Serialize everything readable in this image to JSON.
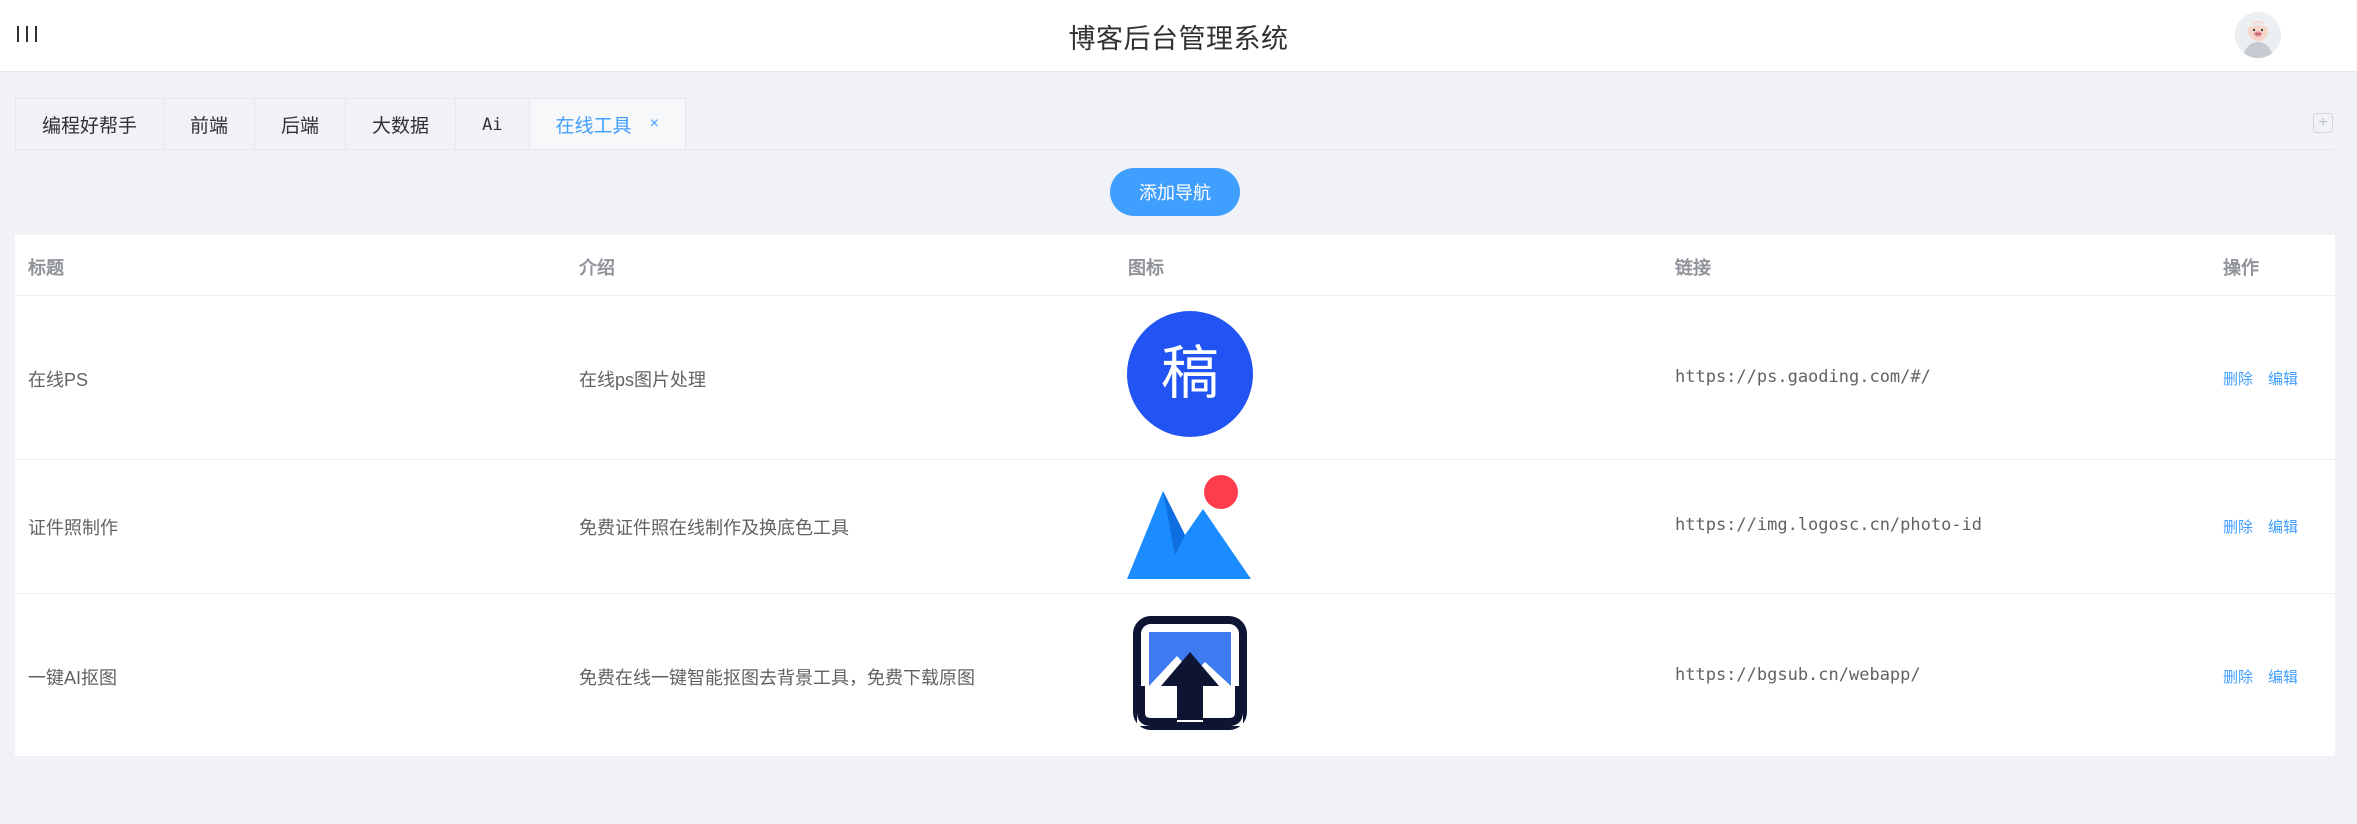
{
  "header": {
    "menu_icon": "menu-toggle-icon",
    "title": "博客后台管理系统",
    "avatar_icon": "user-avatar"
  },
  "tabs": [
    {
      "label": "编程好帮手",
      "active": false
    },
    {
      "label": "前端",
      "active": false
    },
    {
      "label": "后端",
      "active": false
    },
    {
      "label": "大数据",
      "active": false
    },
    {
      "label": "Ai",
      "active": false
    },
    {
      "label": "在线工具",
      "active": true,
      "close": "×"
    }
  ],
  "tab_add": "+",
  "toolbar": {
    "add_nav_label": "添加导航"
  },
  "table": {
    "headers": [
      "标题",
      "介绍",
      "图标",
      "链接",
      "操作"
    ],
    "rows": [
      {
        "title": "在线PS",
        "intro": "在线ps图片处理",
        "icon": "gaoding-logo",
        "icon_text": "稿",
        "link": "https://ps.gaoding.com/#/",
        "delete": "删除",
        "edit": "编辑"
      },
      {
        "title": "证件照制作",
        "intro": "免费证件照在线制作及换底色工具",
        "icon": "logosc-logo",
        "link": "https://img.logosc.cn/photo-id",
        "delete": "删除",
        "edit": "编辑"
      },
      {
        "title": "一键AI抠图",
        "intro": "免费在线一键智能抠图去背景工具，免费下载原图",
        "icon": "bgsub-logo",
        "link": "https://bgsub.cn/webapp/",
        "delete": "删除",
        "edit": "编辑"
      }
    ]
  },
  "colors": {
    "accent": "#409eff",
    "gaoding_blue": "#2254f4",
    "logosc_blue": "#1a8cff",
    "logosc_red": "#ff3b4e",
    "bgsub_navy": "#0d1533"
  }
}
